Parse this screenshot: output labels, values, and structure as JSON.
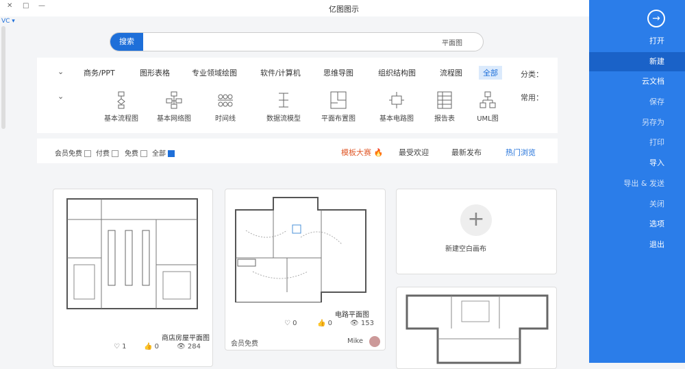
{
  "window": {
    "title": "亿图图示",
    "min": "—",
    "max": "□",
    "close": "✕"
  },
  "account": {
    "label": "VC ▾"
  },
  "nav": {
    "items": [
      {
        "label": "打开",
        "state": "normal"
      },
      {
        "label": "新建",
        "state": "active"
      },
      {
        "label": "云文档",
        "state": "normal"
      },
      {
        "label": "保存",
        "state": "dim"
      },
      {
        "label": "另存为",
        "state": "dim"
      },
      {
        "label": "打印",
        "state": "dim"
      },
      {
        "label": "导入",
        "state": "normal"
      },
      {
        "label": "导出 & 发送",
        "state": "dim"
      },
      {
        "label": "关闭",
        "state": "dim"
      },
      {
        "label": "选项",
        "state": "normal"
      },
      {
        "label": "退出",
        "state": "normal"
      }
    ]
  },
  "search": {
    "button": "搜索",
    "placeholder": "平面图"
  },
  "categories": {
    "label": "分类：",
    "items": [
      "全部",
      "流程图",
      "组织结构图",
      "思维导图",
      "软件/计算机",
      "专业领域绘图",
      "图形表格",
      "商务/PPT"
    ],
    "selected": "全部"
  },
  "common": {
    "label": "常用：",
    "items": [
      "UML图",
      "报告表",
      "基本电路图",
      "平面布置图",
      "数据流模型",
      "时间线",
      "基本网络图",
      "基本流程图"
    ]
  },
  "filters": {
    "tabs": [
      "热门浏览",
      "最新发布",
      "最受欢迎",
      "模板大赛"
    ],
    "active": "热门浏览",
    "hot_icon": "fire-icon",
    "checks": [
      {
        "label": "全部",
        "on": true
      },
      {
        "label": "免费",
        "on": false
      },
      {
        "label": "付费",
        "on": false
      },
      {
        "label": "会员免费",
        "on": false
      }
    ]
  },
  "cards": [
    {
      "name": "商店房屋平面图",
      "views": "284",
      "likes": "0",
      "comments": "1"
    },
    {
      "name": "电路平面图",
      "views": "153",
      "likes": "0",
      "comments": "0",
      "author": "Mike",
      "badge": "会员免费"
    },
    {
      "name": "新建空白画布"
    }
  ],
  "colors": {
    "accent": "#1e6fd9",
    "nav": "#2b7de9",
    "hot": "#e05a2b"
  }
}
